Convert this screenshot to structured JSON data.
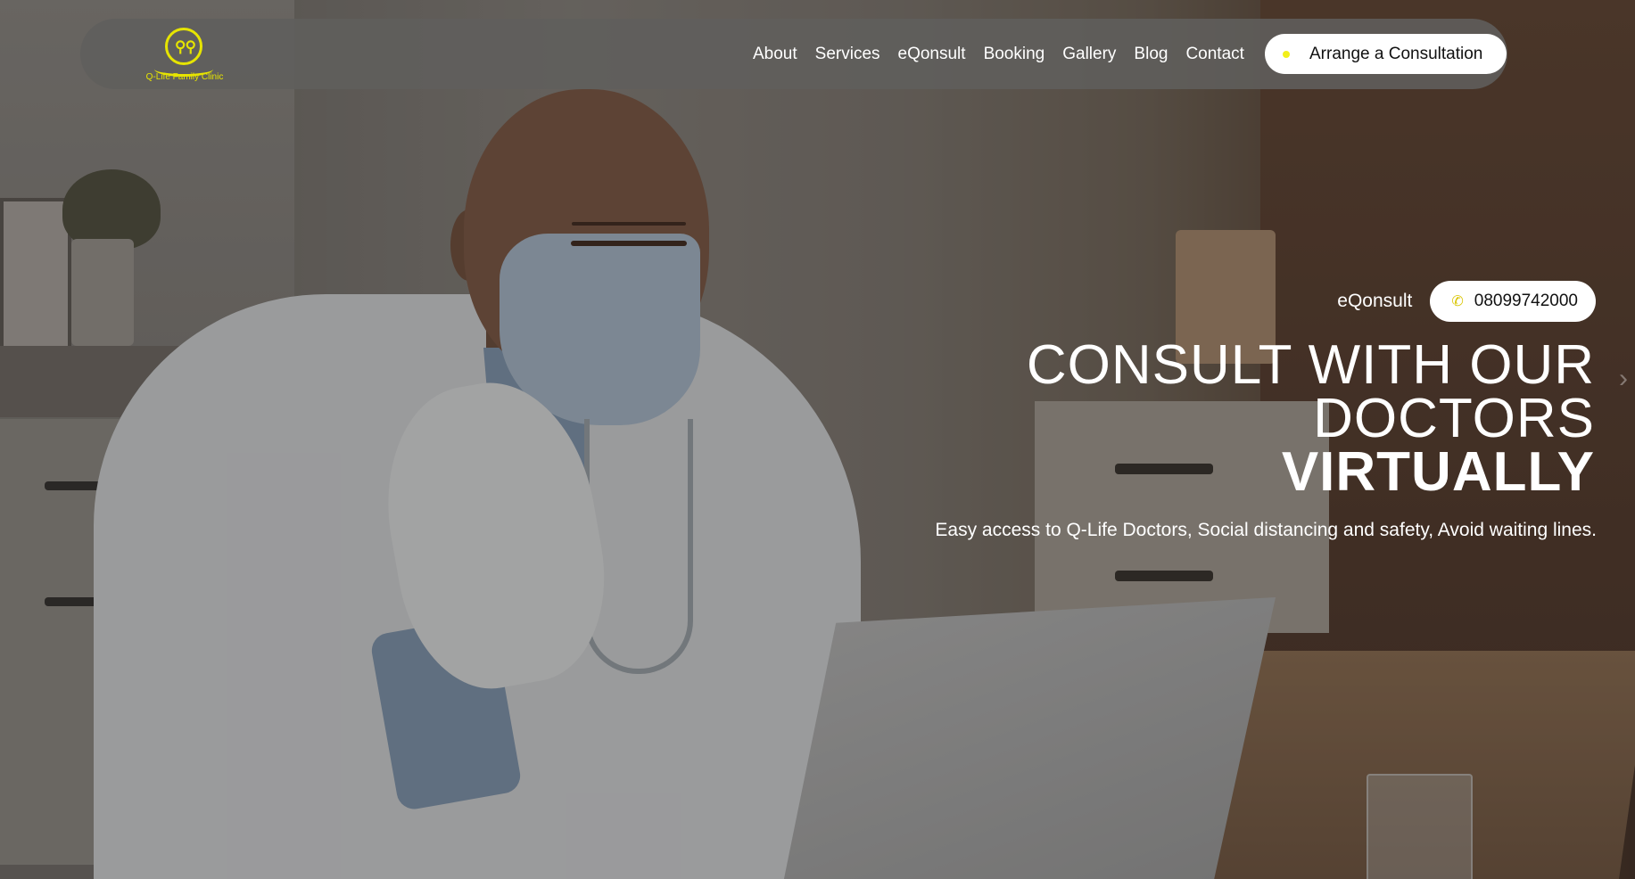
{
  "brand": {
    "logo_text": "Q-Life Family Clinic"
  },
  "nav": {
    "items": [
      "About",
      "Services",
      "eQonsult",
      "Booking",
      "Gallery",
      "Blog",
      "Contact"
    ],
    "cta_label": "Arrange a Consultation"
  },
  "hero": {
    "sub_link": "eQonsult",
    "phone": "08099742000",
    "headline_line1": "CONSULT WITH OUR",
    "headline_line2": "DOCTORS",
    "headline_line3": "VIRTUALLY",
    "tagline": "Easy access to Q-Life Doctors, Social distancing and safety, Avoid waiting lines."
  },
  "colors": {
    "accent": "#e6e400",
    "nav_bg": "#605e5c",
    "button_bg": "#ffffff"
  },
  "icons": {
    "phone": "phone-icon",
    "cta_dot": "dot-icon"
  }
}
